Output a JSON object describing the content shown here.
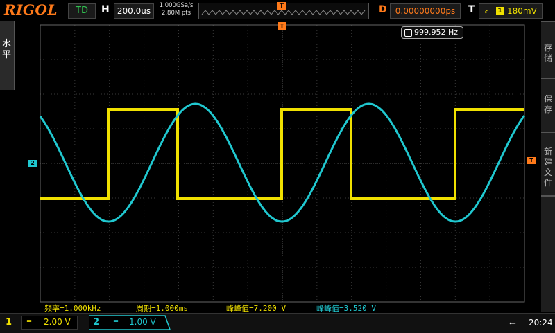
{
  "header": {
    "logo": "RIGOL",
    "run_mode": "TD",
    "h_label": "H",
    "timebase": "200.0us",
    "sample_rate": "1.000GSa/s",
    "mem_depth": "2.80M pts",
    "trigger_marker": "T",
    "delay_label": "D",
    "delay_value": "0.00000000ps",
    "trigger_label": "T",
    "trigger_edge": "rising-edge-icon",
    "trigger_source": "1",
    "trigger_level": "180mV"
  },
  "left_menu": {
    "label": "水平"
  },
  "right_menu": {
    "items": [
      {
        "label": "存储"
      },
      {
        "label": "保存"
      },
      {
        "label": "新建文件"
      }
    ]
  },
  "markers": {
    "ch2_ground": "2",
    "trigger_level": "T",
    "trigger_position": "T"
  },
  "frequency_counter": {
    "icon": "counter-icon",
    "value": "999.952 Hz"
  },
  "measurements": [
    {
      "text": "频率=1.000kHz",
      "color": "#f0e000"
    },
    {
      "text": "周期=1.000ms",
      "color": "#f0e000"
    },
    {
      "text": "峰峰值=7.200 V",
      "color": "#f0e000"
    },
    {
      "text": "峰峰值=3.520 V",
      "color": "#20c8d0"
    }
  ],
  "channels": {
    "ch1": {
      "number": "1",
      "coupling": "═",
      "scale": "2.00 V",
      "color": "#f0e000"
    },
    "ch2": {
      "number": "2",
      "coupling": "═",
      "scale": "1.00 V",
      "color": "#20c8d0"
    }
  },
  "status": {
    "usb_icon": "usb-icon",
    "time": "20:24"
  },
  "colors": {
    "ch1": "#f0e000",
    "ch2": "#20c8d0",
    "trigger": "#ff7a1a",
    "grid": "#3a3a3a"
  },
  "waveforms": {
    "ch1_type": "square",
    "ch2_type": "sine",
    "ch2_frequency": "1.000kHz",
    "ch1_frequency": "1.000kHz"
  }
}
